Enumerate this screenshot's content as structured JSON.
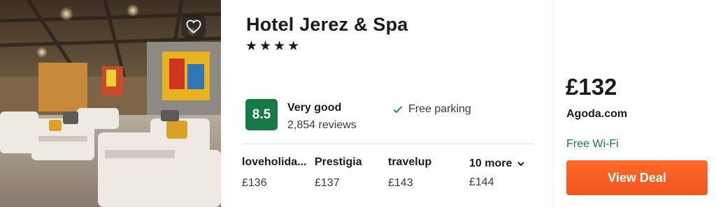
{
  "hotel": {
    "name": "Hotel Jerez & Spa",
    "stars_text": "★★★★",
    "rating_score": "8.5",
    "rating_word": "Very good",
    "reviews": "2,854 reviews",
    "amenity": "Free parking"
  },
  "providers": [
    {
      "name": "loveholida...",
      "price": "£136"
    },
    {
      "name": "Prestigia",
      "price": "£137"
    },
    {
      "name": "travelup",
      "price": "£143"
    }
  ],
  "more": {
    "label": "10 more",
    "price": "£144"
  },
  "deal": {
    "price": "£132",
    "source": "Agoda.com",
    "perk": "Free Wi-Fi",
    "button_label": "View Deal"
  },
  "icons": {
    "favorite": "heart-icon",
    "amenity": "check-icon",
    "more": "chevron-down-icon"
  },
  "colors": {
    "rating_green": "#177a44",
    "cta_orange": "#f2561d",
    "perk_green": "#177a44"
  }
}
